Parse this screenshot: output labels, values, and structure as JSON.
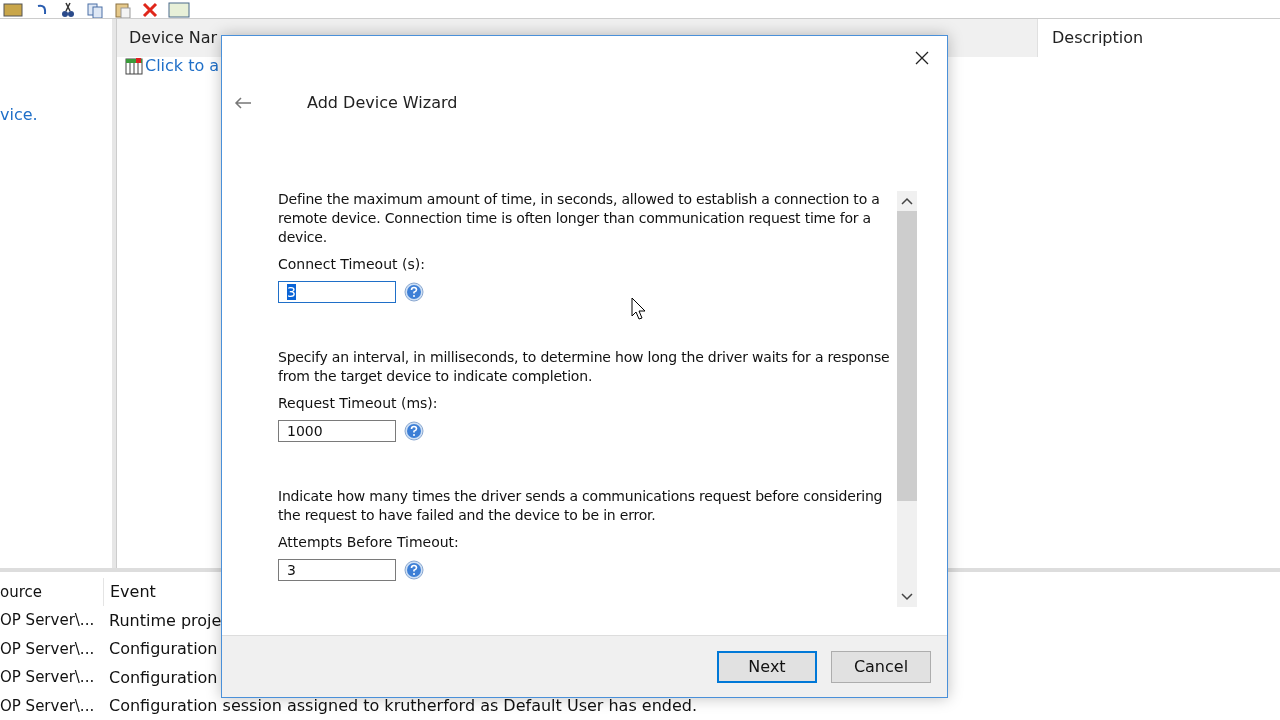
{
  "left_pane": {
    "link": "vice."
  },
  "device_table": {
    "columns": [
      "Device Nar",
      "Description"
    ],
    "add_link": "Click to a"
  },
  "event_log": {
    "columns": [
      "ource",
      "Event"
    ],
    "rows": [
      {
        "source": "OP Server\\...",
        "event": "Runtime proje"
      },
      {
        "source": "OP Server\\...",
        "event": "Configuration"
      },
      {
        "source": "OP Server\\...",
        "event": "Configuration"
      },
      {
        "source": "OP Server\\...",
        "event": "Configuration session assigned to krutherford as Default User has ended."
      }
    ]
  },
  "dialog": {
    "title": "Add Device Wizard",
    "settings": [
      {
        "description": "Define the maximum amount of time, in seconds, allowed to establish a connection to a remote device. Connection time is often longer than communication request time for a device.",
        "label": "Connect Timeout (s):",
        "value": "3",
        "focused": true
      },
      {
        "description": "Specify an interval, in milliseconds, to determine how long the driver waits for a response from the target device to indicate completion.",
        "label": "Request Timeout (ms):",
        "value": "1000",
        "focused": false
      },
      {
        "description": "Indicate how many times the driver sends a communications request before considering the request to have failed and the device to be in error.",
        "label": "Attempts Before Timeout:",
        "value": "3",
        "focused": false
      }
    ],
    "buttons": [
      {
        "label": "Next",
        "selected": true
      },
      {
        "label": "Cancel",
        "selected": false
      }
    ]
  }
}
